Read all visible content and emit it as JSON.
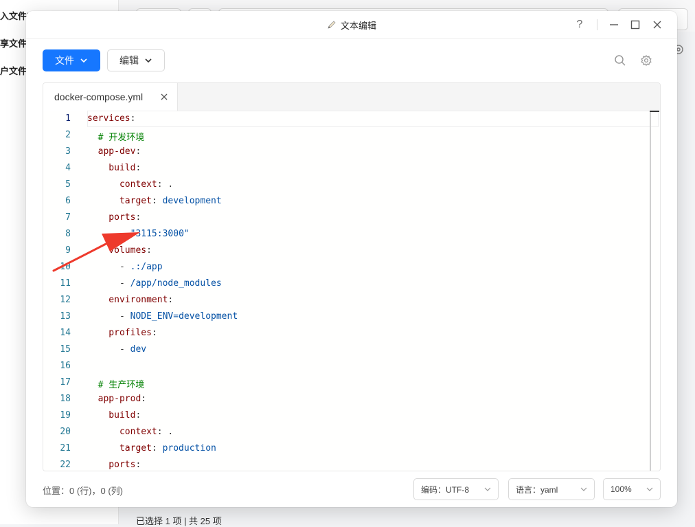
{
  "background": {
    "sidebar_items": [
      "入文件夹",
      "享文件夹",
      "户文件夹"
    ],
    "status": "已选择 1 项 | 共 25 项"
  },
  "window": {
    "title": "文本编辑",
    "help": "?",
    "minimize": "—",
    "maximize": "☐",
    "close": "✕"
  },
  "toolbar": {
    "file_label": "文件",
    "edit_label": "编辑"
  },
  "tab": {
    "filename": "docker-compose.yml"
  },
  "code": [
    {
      "n": "1",
      "parts": [
        {
          "t": "services",
          "c": "k"
        },
        {
          "t": ":",
          "c": "p"
        }
      ]
    },
    {
      "n": "2",
      "parts": [
        {
          "t": "  # 开发环境",
          "c": "c"
        }
      ]
    },
    {
      "n": "3",
      "parts": [
        {
          "t": "  app-dev",
          "c": "k"
        },
        {
          "t": ":",
          "c": "p"
        }
      ]
    },
    {
      "n": "4",
      "parts": [
        {
          "t": "    build",
          "c": "k"
        },
        {
          "t": ":",
          "c": "p"
        }
      ]
    },
    {
      "n": "5",
      "parts": [
        {
          "t": "      context",
          "c": "k"
        },
        {
          "t": ": .",
          "c": "p"
        }
      ]
    },
    {
      "n": "6",
      "parts": [
        {
          "t": "      target",
          "c": "k"
        },
        {
          "t": ": ",
          "c": "p"
        },
        {
          "t": "development",
          "c": "s"
        }
      ]
    },
    {
      "n": "7",
      "parts": [
        {
          "t": "    ports",
          "c": "k"
        },
        {
          "t": ":",
          "c": "p"
        }
      ]
    },
    {
      "n": "8",
      "parts": [
        {
          "t": "      - ",
          "c": "p"
        },
        {
          "t": "\"3115:3000\"",
          "c": "s"
        }
      ]
    },
    {
      "n": "9",
      "parts": [
        {
          "t": "    volumes",
          "c": "k"
        },
        {
          "t": ":",
          "c": "p"
        }
      ]
    },
    {
      "n": "10",
      "parts": [
        {
          "t": "      - ",
          "c": "p"
        },
        {
          "t": ".:/app",
          "c": "s"
        }
      ]
    },
    {
      "n": "11",
      "parts": [
        {
          "t": "      - ",
          "c": "p"
        },
        {
          "t": "/app/node_modules",
          "c": "s"
        }
      ]
    },
    {
      "n": "12",
      "parts": [
        {
          "t": "    environment",
          "c": "k"
        },
        {
          "t": ":",
          "c": "p"
        }
      ]
    },
    {
      "n": "13",
      "parts": [
        {
          "t": "      - ",
          "c": "p"
        },
        {
          "t": "NODE_ENV=development",
          "c": "s"
        }
      ]
    },
    {
      "n": "14",
      "parts": [
        {
          "t": "    profiles",
          "c": "k"
        },
        {
          "t": ":",
          "c": "p"
        }
      ]
    },
    {
      "n": "15",
      "parts": [
        {
          "t": "      - ",
          "c": "p"
        },
        {
          "t": "dev",
          "c": "s"
        }
      ]
    },
    {
      "n": "16",
      "parts": []
    },
    {
      "n": "17",
      "parts": [
        {
          "t": "  # 生产环境",
          "c": "c"
        }
      ]
    },
    {
      "n": "18",
      "parts": [
        {
          "t": "  app-prod",
          "c": "k"
        },
        {
          "t": ":",
          "c": "p"
        }
      ]
    },
    {
      "n": "19",
      "parts": [
        {
          "t": "    build",
          "c": "k"
        },
        {
          "t": ":",
          "c": "p"
        }
      ]
    },
    {
      "n": "20",
      "parts": [
        {
          "t": "      context",
          "c": "k"
        },
        {
          "t": ": .",
          "c": "p"
        }
      ]
    },
    {
      "n": "21",
      "parts": [
        {
          "t": "      target",
          "c": "k"
        },
        {
          "t": ": ",
          "c": "p"
        },
        {
          "t": "production",
          "c": "s"
        }
      ]
    },
    {
      "n": "22",
      "parts": [
        {
          "t": "    ports",
          "c": "k"
        },
        {
          "t": ":",
          "c": "p"
        }
      ]
    }
  ],
  "footer": {
    "position": "位置：0 (行)，0 (列)",
    "encoding": "编码：UTF-8",
    "language": "语言：yaml",
    "zoom": "100%"
  },
  "colors": {
    "primary": "#1677ff",
    "annotation_arrow": "#ee3a2c"
  }
}
